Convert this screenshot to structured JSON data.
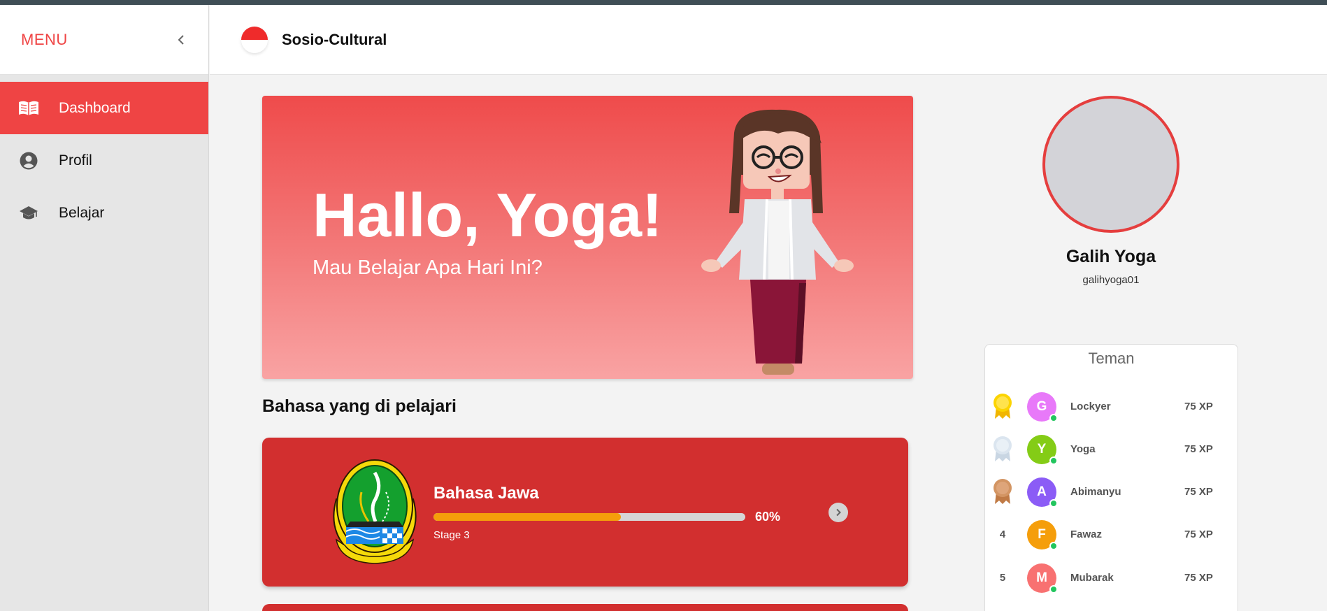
{
  "sidebar": {
    "menu_label": "MENU",
    "collapse_icon": "chevron-left-icon",
    "items": [
      {
        "label": "Dashboard",
        "icon": "book-open-icon",
        "active": true
      },
      {
        "label": "Profil",
        "icon": "user-circle-icon",
        "active": false
      },
      {
        "label": "Belajar",
        "icon": "graduation-cap-icon",
        "active": false
      }
    ]
  },
  "header": {
    "title": "Sosio-Cultural",
    "flag_icon": "indonesia-flag-icon"
  },
  "hero": {
    "greeting": "Hallo, Yoga!",
    "subtitle": "Mau Belajar Apa Hari Ini?"
  },
  "courses": {
    "section_title": "Bahasa yang di pelajari",
    "items": [
      {
        "name": "Bahasa Jawa",
        "progress": 60,
        "progress_label": "60%",
        "stage": "Stage 3"
      }
    ]
  },
  "profile": {
    "name": "Galih Yoga",
    "username": "galihyoga01"
  },
  "friends": {
    "title": "Teman",
    "items": [
      {
        "rank": "",
        "medal": "gold",
        "initial": "G",
        "name": "Lockyer",
        "xp": "75 XP",
        "color": "#e879f9"
      },
      {
        "rank": "",
        "medal": "silver",
        "initial": "Y",
        "name": "Yoga",
        "xp": "75 XP",
        "color": "#84cc16"
      },
      {
        "rank": "",
        "medal": "bronze",
        "initial": "A",
        "name": "Abimanyu",
        "xp": "75 XP",
        "color": "#8b5cf6"
      },
      {
        "rank": "4",
        "medal": "",
        "initial": "F",
        "name": "Fawaz",
        "xp": "75 XP",
        "color": "#f59e0b"
      },
      {
        "rank": "5",
        "medal": "",
        "initial": "M",
        "name": "Mubarak",
        "xp": "75 XP",
        "color": "#f87171"
      }
    ]
  },
  "colors": {
    "accent": "#ef4444",
    "card": "#d22f2f",
    "progress": "#f59e0b",
    "online": "#22c55e"
  }
}
